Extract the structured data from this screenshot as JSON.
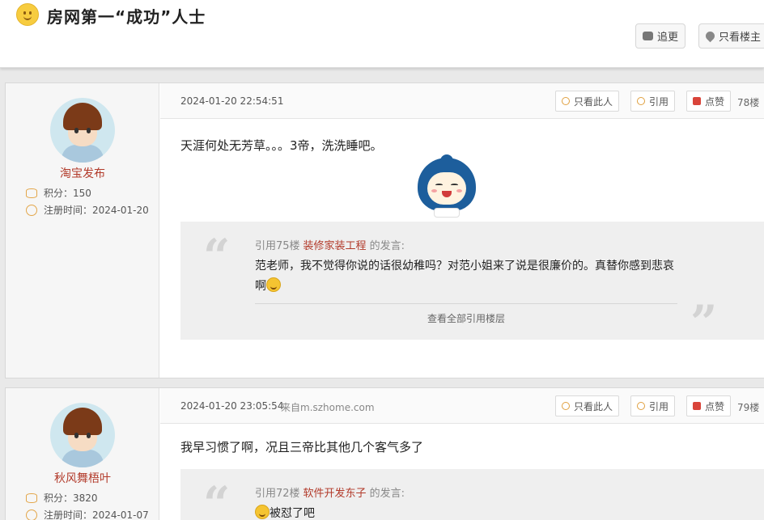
{
  "header": {
    "title": "房网第一“成功”人士",
    "reply_label": "追更",
    "owner_only_label": "只看楼主"
  },
  "posts": [
    {
      "author": "淘宝发布",
      "score_label": "积分：",
      "score": "150",
      "reg_label": "注册时间：",
      "reg_date": "2024-01-20",
      "time": "2024-01-20 22:54:51",
      "source": "",
      "only_this_label": "只看此人",
      "quote_label": "引用",
      "like_label": "点赞",
      "floor": "78楼",
      "text": "天涯何处无芳草。。。3帝，洗洗睡吧。",
      "quote": {
        "prefix": "引用75楼",
        "name": "装修家装工程",
        "suffix": "的发言:",
        "body": "范老师，我不觉得你说的话很幼稚吗？对范小姐来了说是很廉价的。真替你感到悲哀啊",
        "view_all": "查看全部引用楼层"
      }
    },
    {
      "author": "秋风舞梧叶",
      "score_label": "积分：",
      "score": "3820",
      "reg_label": "注册时间：",
      "reg_date": "2024-01-07",
      "time": "2024-01-20 23:05:54",
      "source": "来自m.szhome.com",
      "only_this_label": "只看此人",
      "quote_label": "引用",
      "like_label": "点赞",
      "floor": "79楼",
      "text": "我早习惯了啊，况且三帝比其他几个客气多了",
      "quote": {
        "prefix": "引用72楼",
        "name": "软件开发东子",
        "suffix": "的发言:",
        "body": "被怼了吧"
      }
    }
  ],
  "colors": {
    "accent": "#b23a2a",
    "quote_bg": "#efefef"
  }
}
